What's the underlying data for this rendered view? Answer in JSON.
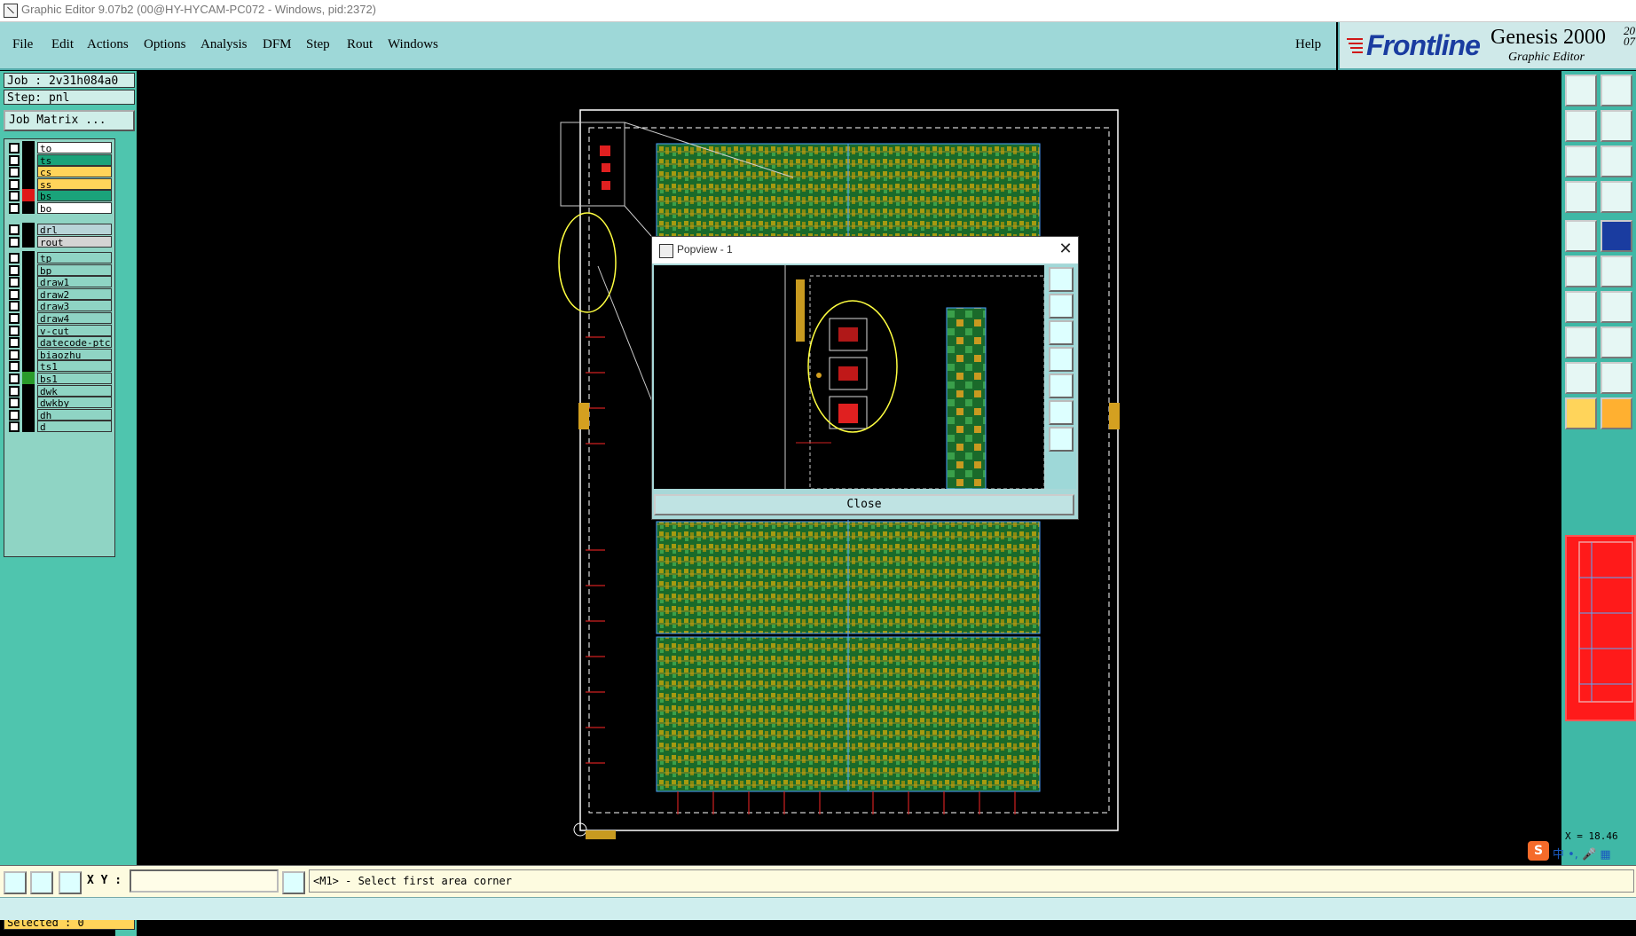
{
  "window": {
    "title": "Graphic Editor 9.07b2 (00@HY-HYCAM-PC072 - Windows, pid:2372)"
  },
  "menu": {
    "items": [
      {
        "label": "File"
      },
      {
        "label": "Edit"
      },
      {
        "label": "Actions"
      },
      {
        "label": "Options"
      },
      {
        "label": "Analysis"
      },
      {
        "label": "DFM"
      },
      {
        "label": "Step"
      },
      {
        "label": "Rout"
      },
      {
        "label": "Windows"
      }
    ],
    "help": "Help"
  },
  "brand": {
    "logo": "Frontline",
    "product": "Genesis 2000",
    "subtitle": "Graphic Editor",
    "version": "20\n07"
  },
  "job": {
    "job_label": "Job : 2v31h084a0",
    "step_label": "Step: pnl",
    "matrix_button": "Job Matrix ..."
  },
  "layers": [
    {
      "name": "to",
      "color": "#ffffff",
      "swatch": "#000000"
    },
    {
      "name": "ts",
      "color": "#1aa37a",
      "swatch": "#000000"
    },
    {
      "name": "cs",
      "color": "#ffd45a",
      "swatch": "#000000"
    },
    {
      "name": "ss",
      "color": "#ffd45a",
      "swatch": "#000000"
    },
    {
      "name": "bs",
      "color": "#1aa37a",
      "swatch": "#e01818"
    },
    {
      "name": "bo",
      "color": "#ffffff",
      "swatch": "#000000"
    },
    {
      "name": "drl",
      "color": "#b8d4d8",
      "swatch": "#000000"
    },
    {
      "name": "rout",
      "color": "#d4d4d4",
      "swatch": "#000000"
    },
    {
      "name": "tp",
      "color": "#8fd4c4",
      "swatch": "#000000"
    },
    {
      "name": "bp",
      "color": "#8fd4c4",
      "swatch": "#000000"
    },
    {
      "name": "draw1",
      "color": "#8fd4c4",
      "swatch": "#000000"
    },
    {
      "name": "draw2",
      "color": "#8fd4c4",
      "swatch": "#000000"
    },
    {
      "name": "draw3",
      "color": "#8fd4c4",
      "swatch": "#000000"
    },
    {
      "name": "draw4",
      "color": "#8fd4c4",
      "swatch": "#000000"
    },
    {
      "name": "v-cut",
      "color": "#8fd4c4",
      "swatch": "#000000"
    },
    {
      "name": "datecode-ptc",
      "color": "#8fd4c4",
      "swatch": "#000000"
    },
    {
      "name": "biaozhu",
      "color": "#8fd4c4",
      "swatch": "#000000"
    },
    {
      "name": "ts1",
      "color": "#8fd4c4",
      "swatch": "#000000"
    },
    {
      "name": "bs1",
      "color": "#8fd4c4",
      "swatch": "#2a9a2a"
    },
    {
      "name": "dwk",
      "color": "#8fd4c4",
      "swatch": "#000000"
    },
    {
      "name": "dwkby",
      "color": "#8fd4c4",
      "swatch": "#000000"
    },
    {
      "name": "dh",
      "color": "#8fd4c4",
      "swatch": "#000000"
    },
    {
      "name": "d",
      "color": "#8fd4c4",
      "swatch": "#000000"
    }
  ],
  "selected": "Selected : 0",
  "popview": {
    "title": "Popview - 1",
    "close_button": "Close"
  },
  "bottom": {
    "xy_label": "X Y :",
    "xy_value": "",
    "message": "<M1> - Select first area corner"
  },
  "right_coord": "X = 18.46",
  "colors": {
    "accent": "#9ed8d8",
    "panel": "#4fc5ae",
    "board_fill": "#8a8a10",
    "board_copper": "#1a8a3a",
    "highlight": "#ffff66"
  }
}
